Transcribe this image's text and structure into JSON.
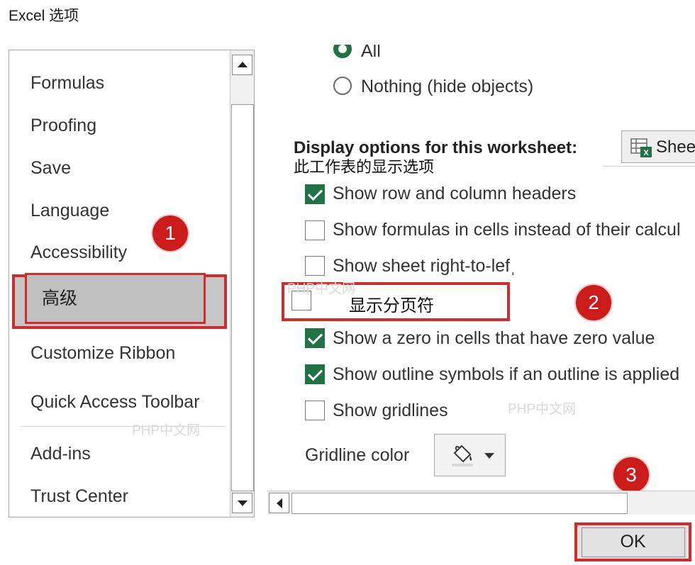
{
  "window": {
    "title": "Excel 选项"
  },
  "nav": {
    "items": [
      {
        "label": "Formulas"
      },
      {
        "label": "Proofing"
      },
      {
        "label": "Save"
      },
      {
        "label": "Language"
      },
      {
        "label": "Accessibility"
      },
      {
        "label": "高级",
        "selected": true
      },
      {
        "label": "Customize Ribbon"
      },
      {
        "label": "Quick Access Toolbar"
      },
      {
        "label": "Add-ins"
      },
      {
        "label": "Trust Center"
      }
    ]
  },
  "objects": {
    "options": [
      {
        "label": "All",
        "checked": true
      },
      {
        "label": "Nothing (hide objects)",
        "checked": false
      }
    ]
  },
  "worksheet_section": {
    "heading": "Display options for this worksheet:",
    "subtitle": "此工作表的显示选项",
    "sheet_value": "Shee",
    "options": [
      {
        "label": "Show row and column headers",
        "checked": true
      },
      {
        "label": "Show formulas in cells instead of their calcul",
        "checked": false
      },
      {
        "label": "Show sheet right-to-lefˌ",
        "checked": false
      },
      {
        "label": "显示分页符",
        "checked": false
      },
      {
        "label": "Show a zero in cells that have zero value",
        "checked": true
      },
      {
        "label": "Show outline symbols if an outline is applied",
        "checked": true
      },
      {
        "label": "Show gridlines",
        "checked": false
      }
    ],
    "gridline_color_label": "Gridline color"
  },
  "badges": [
    "1",
    "2",
    "3"
  ],
  "buttons": {
    "ok": "OK"
  },
  "watermarks": [
    "PHP中文网",
    "PHP中文网",
    "PHP中文网"
  ],
  "icons": {
    "sheet": "excel-sheet-icon",
    "paint": "paint-bucket-icon"
  },
  "colors": {
    "accent": "#217346",
    "highlight": "#d32a2a",
    "badge": "#cc1b1b"
  }
}
